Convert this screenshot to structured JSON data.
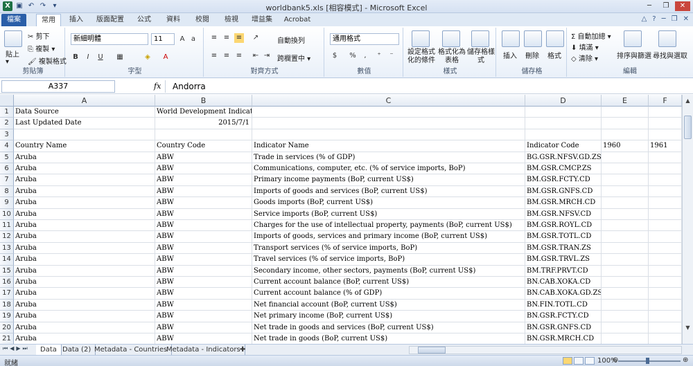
{
  "window": {
    "title": "worldbank5.xls [相容模式] - Microsoft Excel",
    "quick_access": [
      "save-icon",
      "undo-icon",
      "redo-icon"
    ]
  },
  "ribbon": {
    "tabs": [
      "檔案",
      "常用",
      "插入",
      "版面配置",
      "公式",
      "資料",
      "校閱",
      "檢視",
      "增益集",
      "Acrobat"
    ],
    "active_tab": "常用",
    "groups": {
      "clipboard": {
        "label": "剪貼簿",
        "paste": "貼上",
        "cut": "剪下",
        "copy": "複製 ▾",
        "format_painter": "複製格式"
      },
      "font": {
        "label": "字型",
        "font_name": "新細明體",
        "font_size": "11"
      },
      "alignment": {
        "label": "對齊方式",
        "wrap": "自動換列",
        "merge": "跨欄置中 ▾"
      },
      "number": {
        "label": "數值",
        "format": "通用格式"
      },
      "styles": {
        "label": "樣式",
        "conditional": "設定格式化的條件",
        "as_table": "格式化為表格",
        "cell_styles": "儲存格樣式"
      },
      "cells": {
        "label": "儲存格",
        "insert": "插入",
        "delete": "刪除",
        "format": "格式"
      },
      "editing": {
        "label": "編輯",
        "autosum": "自動加總 ▾",
        "fill": "填滿 ▾",
        "clear": "清除 ▾",
        "sort": "排序與篩選",
        "find": "尋找與選取"
      }
    }
  },
  "formula_bar": {
    "name_box": "A337",
    "fx": "fx",
    "value": "Andorra"
  },
  "columns": [
    "A",
    "B",
    "C",
    "D",
    "E",
    "F"
  ],
  "rows": [
    {
      "n": "1",
      "a": "Data Source",
      "b": "World Development Indicators",
      "c": "",
      "d": "",
      "e": "",
      "f": ""
    },
    {
      "n": "2",
      "a": "Last Updated Date",
      "b": "2015/7/1",
      "c": "",
      "d": "",
      "e": "",
      "f": ""
    },
    {
      "n": "3",
      "a": "",
      "b": "",
      "c": "",
      "d": "",
      "e": "",
      "f": ""
    },
    {
      "n": "4",
      "a": "Country Name",
      "b": "Country Code",
      "c": "Indicator Name",
      "d": "Indicator Code",
      "e": "1960",
      "f": "1961"
    },
    {
      "n": "5",
      "a": "Aruba",
      "b": "ABW",
      "c": "Trade in services (% of GDP)",
      "d": "BG.GSR.NFSV.GD.ZS",
      "e": "",
      "f": ""
    },
    {
      "n": "6",
      "a": "Aruba",
      "b": "ABW",
      "c": "Communications, computer, etc. (% of service imports, BoP)",
      "d": "BM.GSR.CMCP.ZS",
      "e": "",
      "f": ""
    },
    {
      "n": "7",
      "a": "Aruba",
      "b": "ABW",
      "c": "Primary income payments (BoP, current US$)",
      "d": "BM.GSR.FCTY.CD",
      "e": "",
      "f": ""
    },
    {
      "n": "8",
      "a": "Aruba",
      "b": "ABW",
      "c": "Imports of goods and services (BoP, current US$)",
      "d": "BM.GSR.GNFS.CD",
      "e": "",
      "f": ""
    },
    {
      "n": "9",
      "a": "Aruba",
      "b": "ABW",
      "c": "Goods imports (BoP, current US$)",
      "d": "BM.GSR.MRCH.CD",
      "e": "",
      "f": ""
    },
    {
      "n": "10",
      "a": "Aruba",
      "b": "ABW",
      "c": "Service imports (BoP, current US$)",
      "d": "BM.GSR.NFSV.CD",
      "e": "",
      "f": ""
    },
    {
      "n": "11",
      "a": "Aruba",
      "b": "ABW",
      "c": "Charges for the use of intellectual property, payments (BoP, current US$)",
      "d": "BM.GSR.ROYL.CD",
      "e": "",
      "f": ""
    },
    {
      "n": "12",
      "a": "Aruba",
      "b": "ABW",
      "c": "Imports of goods, services and primary income (BoP, current US$)",
      "d": "BM.GSR.TOTL.CD",
      "e": "",
      "f": ""
    },
    {
      "n": "13",
      "a": "Aruba",
      "b": "ABW",
      "c": "Transport services (% of service imports, BoP)",
      "d": "BM.GSR.TRAN.ZS",
      "e": "",
      "f": ""
    },
    {
      "n": "14",
      "a": "Aruba",
      "b": "ABW",
      "c": "Travel services (% of service imports, BoP)",
      "d": "BM.GSR.TRVL.ZS",
      "e": "",
      "f": ""
    },
    {
      "n": "15",
      "a": "Aruba",
      "b": "ABW",
      "c": "Secondary income, other sectors, payments (BoP, current US$)",
      "d": "BM.TRF.PRVT.CD",
      "e": "",
      "f": ""
    },
    {
      "n": "16",
      "a": "Aruba",
      "b": "ABW",
      "c": "Current account balance (BoP, current US$)",
      "d": "BN.CAB.XOKA.CD",
      "e": "",
      "f": ""
    },
    {
      "n": "17",
      "a": "Aruba",
      "b": "ABW",
      "c": "Current account balance (% of GDP)",
      "d": "BN.CAB.XOKA.GD.ZS",
      "e": "",
      "f": ""
    },
    {
      "n": "18",
      "a": "Aruba",
      "b": "ABW",
      "c": "Net financial account (BoP, current US$)",
      "d": "BN.FIN.TOTL.CD",
      "e": "",
      "f": ""
    },
    {
      "n": "19",
      "a": "Aruba",
      "b": "ABW",
      "c": "Net primary income (BoP, current US$)",
      "d": "BN.GSR.FCTY.CD",
      "e": "",
      "f": ""
    },
    {
      "n": "20",
      "a": "Aruba",
      "b": "ABW",
      "c": "Net trade in goods and services (BoP, current US$)",
      "d": "BN.GSR.GNFS.CD",
      "e": "",
      "f": ""
    },
    {
      "n": "21",
      "a": "Aruba",
      "b": "ABW",
      "c": "Net trade in goods (BoP, current US$)",
      "d": "BN.GSR.MRCH.CD",
      "e": "",
      "f": ""
    }
  ],
  "sheets": [
    "Data",
    "Data (2)",
    "Metadata - Countries",
    "Metadata - Indicators"
  ],
  "active_sheet": "Data",
  "status": {
    "ready": "就緒",
    "zoom": "100%"
  }
}
